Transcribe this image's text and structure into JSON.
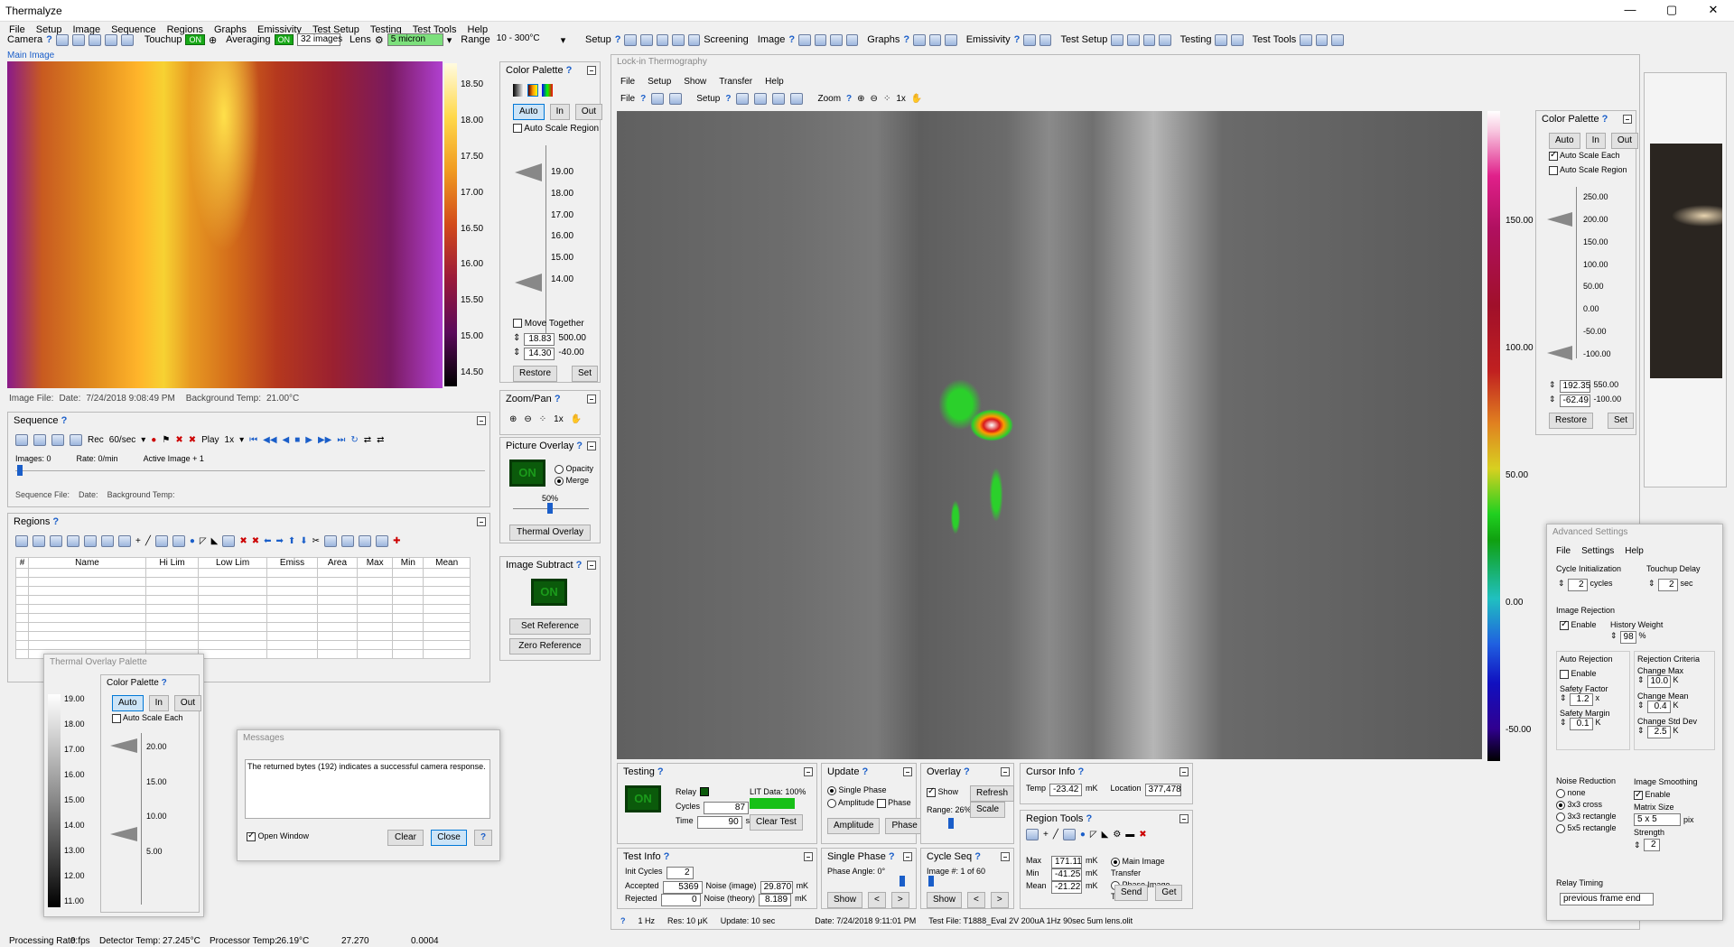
{
  "app": {
    "title": "Thermalyze",
    "win_min": "—",
    "win_max": "▢",
    "win_close": "✕"
  },
  "menu": [
    "File",
    "Setup",
    "Image",
    "Sequence",
    "Regions",
    "Graphs",
    "Emissivity",
    "Test Setup",
    "Testing",
    "Test Tools",
    "Help"
  ],
  "toolbar": {
    "camera": "Camera",
    "q": "?",
    "touchup": "Touchup",
    "touchup_on": "ON",
    "averaging": "Averaging",
    "averaging_on": "ON",
    "averaging_value": "32 images",
    "lens": "Lens",
    "lens_value": "5 micron",
    "range": "Range",
    "range_value": "10 - 300°C",
    "right": [
      "Setup",
      "Screening",
      "Image",
      "Graphs",
      "Emissivity",
      "Test Setup",
      "Testing",
      "Test Tools"
    ]
  },
  "main_image": {
    "label": "Main Image",
    "file_label": "Image File:",
    "date_label": "Date:",
    "date": "7/24/2018 9:08:49 PM",
    "bg_label": "Background Temp:",
    "bg": "21.00°C",
    "scale": [
      "18.50",
      "18.00",
      "17.50",
      "17.00",
      "16.50",
      "16.00",
      "15.50",
      "15.00",
      "14.50"
    ]
  },
  "color_palette_left": {
    "title": "Color Palette",
    "auto": "Auto",
    "in": "In",
    "out": "Out",
    "auto_scale_region": "Auto Scale Region",
    "ticks": [
      "19.00",
      "18.00",
      "17.00",
      "16.00",
      "15.00",
      "14.00"
    ],
    "move_together": "Move Together",
    "max": "18.83",
    "max2": "500.00",
    "min": "14.30",
    "min2": "-40.00",
    "restore": "Restore",
    "set": "Set"
  },
  "zoom_pan": {
    "title": "Zoom/Pan",
    "zoom": "1x"
  },
  "picture_overlay": {
    "title": "Picture Overlay",
    "on": "ON",
    "opacity": "Opacity",
    "merge": "Merge",
    "percent": "50%",
    "thermal_overlay": "Thermal Overlay"
  },
  "image_subtract": {
    "title": "Image Subtract",
    "on": "ON",
    "set_ref": "Set Reference",
    "zero_ref": "Zero Reference"
  },
  "sequence": {
    "title": "Sequence",
    "rec": "Rec",
    "rate": "60/sec",
    "play": "Play",
    "play_speed": "1x",
    "images": "Images: 0",
    "rate_label": "Rate: 0/min",
    "active": "Active Image + 1",
    "seq_file": "Sequence File:",
    "date": "Date:",
    "bg": "Background Temp:"
  },
  "regions": {
    "title": "Regions",
    "columns": [
      "#",
      "Name",
      "Hi Lim",
      "Low Lim",
      "Emiss",
      "Area",
      "Max",
      "Min",
      "Mean"
    ]
  },
  "thermal_overlay_palette": {
    "title": "Thermal Overlay Palette",
    "scale": [
      "19.00",
      "18.00",
      "17.00",
      "16.00",
      "15.00",
      "14.00",
      "13.00",
      "12.00",
      "11.00"
    ],
    "color_palette": "Color Palette",
    "auto": "Auto",
    "in": "In",
    "out": "Out",
    "auto_scale_each": "Auto Scale Each",
    "ticks": [
      "20.00",
      "15.00",
      "10.00",
      "5.00"
    ]
  },
  "messages": {
    "title": "Messages",
    "text": "The returned bytes (192) indicates a successful camera response.",
    "open_window": "Open Window",
    "clear": "Clear",
    "close": "Close",
    "q": "?"
  },
  "lockin": {
    "title": "Lock-in Thermography",
    "menu": [
      "File",
      "Setup",
      "Show",
      "Transfer",
      "Help"
    ],
    "tb_file": "File",
    "tb_setup": "Setup",
    "tb_zoom": "Zoom",
    "zoom": "1x",
    "scale": [
      "150.00",
      "100.00",
      "50.00",
      "0.00",
      "-50.00"
    ]
  },
  "testing": {
    "title": "Testing",
    "on": "ON",
    "relay": "Relay",
    "cycles_label": "Cycles",
    "cycles": "87",
    "time_label": "Time",
    "time": "90",
    "sec": "sec",
    "lit_data": "LIT Data: 100%",
    "clear_test": "Clear Test"
  },
  "update": {
    "title": "Update",
    "single_phase": "Single Phase",
    "amplitude": "Amplitude",
    "phase": "Phase",
    "amp_btn": "Amplitude",
    "phase_btn": "Phase"
  },
  "overlay": {
    "title": "Overlay",
    "show": "Show",
    "refresh": "Refresh",
    "range": "Range: 26%",
    "scale": "Scale"
  },
  "cursor_info": {
    "title": "Cursor Info",
    "temp_label": "Temp",
    "temp": "-23.42",
    "mk": "mK",
    "location_label": "Location",
    "location": "377,478"
  },
  "region_tools": {
    "title": "Region Tools",
    "max_label": "Max",
    "max": "171.11",
    "min_label": "Min",
    "min": "-41.25",
    "mean_label": "Mean",
    "mean": "-21.22",
    "mk": "mK",
    "main_transfer": "Main Image Transfer",
    "phase_transfer": "Phase Image Transfer",
    "send": "Send",
    "get": "Get"
  },
  "test_info": {
    "title": "Test Info",
    "init_label": "Init Cycles",
    "init": "2",
    "accepted_label": "Accepted",
    "accepted": "5369",
    "rejected_label": "Rejected",
    "rejected": "0",
    "noise_image_label": "Noise (image)",
    "noise_image": "29.870",
    "noise_theory_label": "Noise (theory)",
    "noise_theory": "8.189",
    "mk": "mK"
  },
  "single_phase": {
    "title": "Single Phase",
    "angle": "Phase Angle: 0°",
    "show": "Show"
  },
  "cycle_seq": {
    "title": "Cycle Seq",
    "image": "Image #: 1 of 60",
    "show": "Show"
  },
  "lockin_status": {
    "freq": "1 Hz",
    "res": "Res: 10 μK",
    "update": "Update: 10 sec",
    "date": "Date: 7/24/2018 9:11:01 PM",
    "file": "Test File: T1888_Eval 2V 200uA 1Hz 90sec 5um lens.olit"
  },
  "color_palette_right": {
    "title": "Color Palette",
    "auto": "Auto",
    "in": "In",
    "out": "Out",
    "auto_scale_each": "Auto Scale Each",
    "auto_scale_region": "Auto Scale Region",
    "ticks": [
      "250.00",
      "200.00",
      "150.00",
      "100.00",
      "50.00",
      "0.00",
      "-50.00",
      "-100.00"
    ],
    "max": "192.35",
    "max2": "550.00",
    "min": "-62.49",
    "min2": "-100.00",
    "restore": "Restore",
    "set": "Set"
  },
  "advanced": {
    "title": "Advanced Settings",
    "menu": [
      "File",
      "Settings",
      "Help"
    ],
    "cycle_init": "Cycle Initialization",
    "cycle_init_val": "2",
    "cycles": "cycles",
    "touchup_delay": "Touchup Delay",
    "touchup_delay_val": "2",
    "sec": "sec",
    "image_rejection": "Image Rejection",
    "enable": "Enable",
    "history_weight": "History Weight",
    "history_val": "98",
    "pct": "%",
    "auto_rejection": "Auto Rejection",
    "rejection_criteria": "Rejection Criteria",
    "enable2": "Enable",
    "change_max": "Change Max",
    "change_max_val": "10.0",
    "k": "K",
    "change_mean": "Change Mean",
    "change_mean_val": "0.4",
    "change_std": "Change Std Dev",
    "change_std_val": "2.5",
    "safety_factor": "Safety Factor",
    "sf_val": "1.2",
    "x": "x",
    "safety_margin": "Safety Margin",
    "sm_val": "0.1",
    "noise_reduction": "Noise Reduction",
    "none": "none",
    "cross": "3x3 cross",
    "rect3": "3x3 rectangle",
    "rect5": "5x5 rectangle",
    "image_smoothing": "Image Smoothing",
    "enable3": "Enable",
    "matrix_size": "Matrix Size",
    "matrix_val": "5 x 5",
    "pix": "pix",
    "strength": "Strength",
    "strength_val": "2",
    "relay_timing": "Relay Timing",
    "relay_val": "previous frame end"
  },
  "status": {
    "processing": "Processing Rate:",
    "proc_val": "0 fps",
    "detector": "Detector Temp:",
    "det_val": "27.245°C",
    "processor": "Processor Temp:",
    "proc_temp": "26.19°C",
    "v1": "27.270",
    "v2": "0.0004"
  }
}
